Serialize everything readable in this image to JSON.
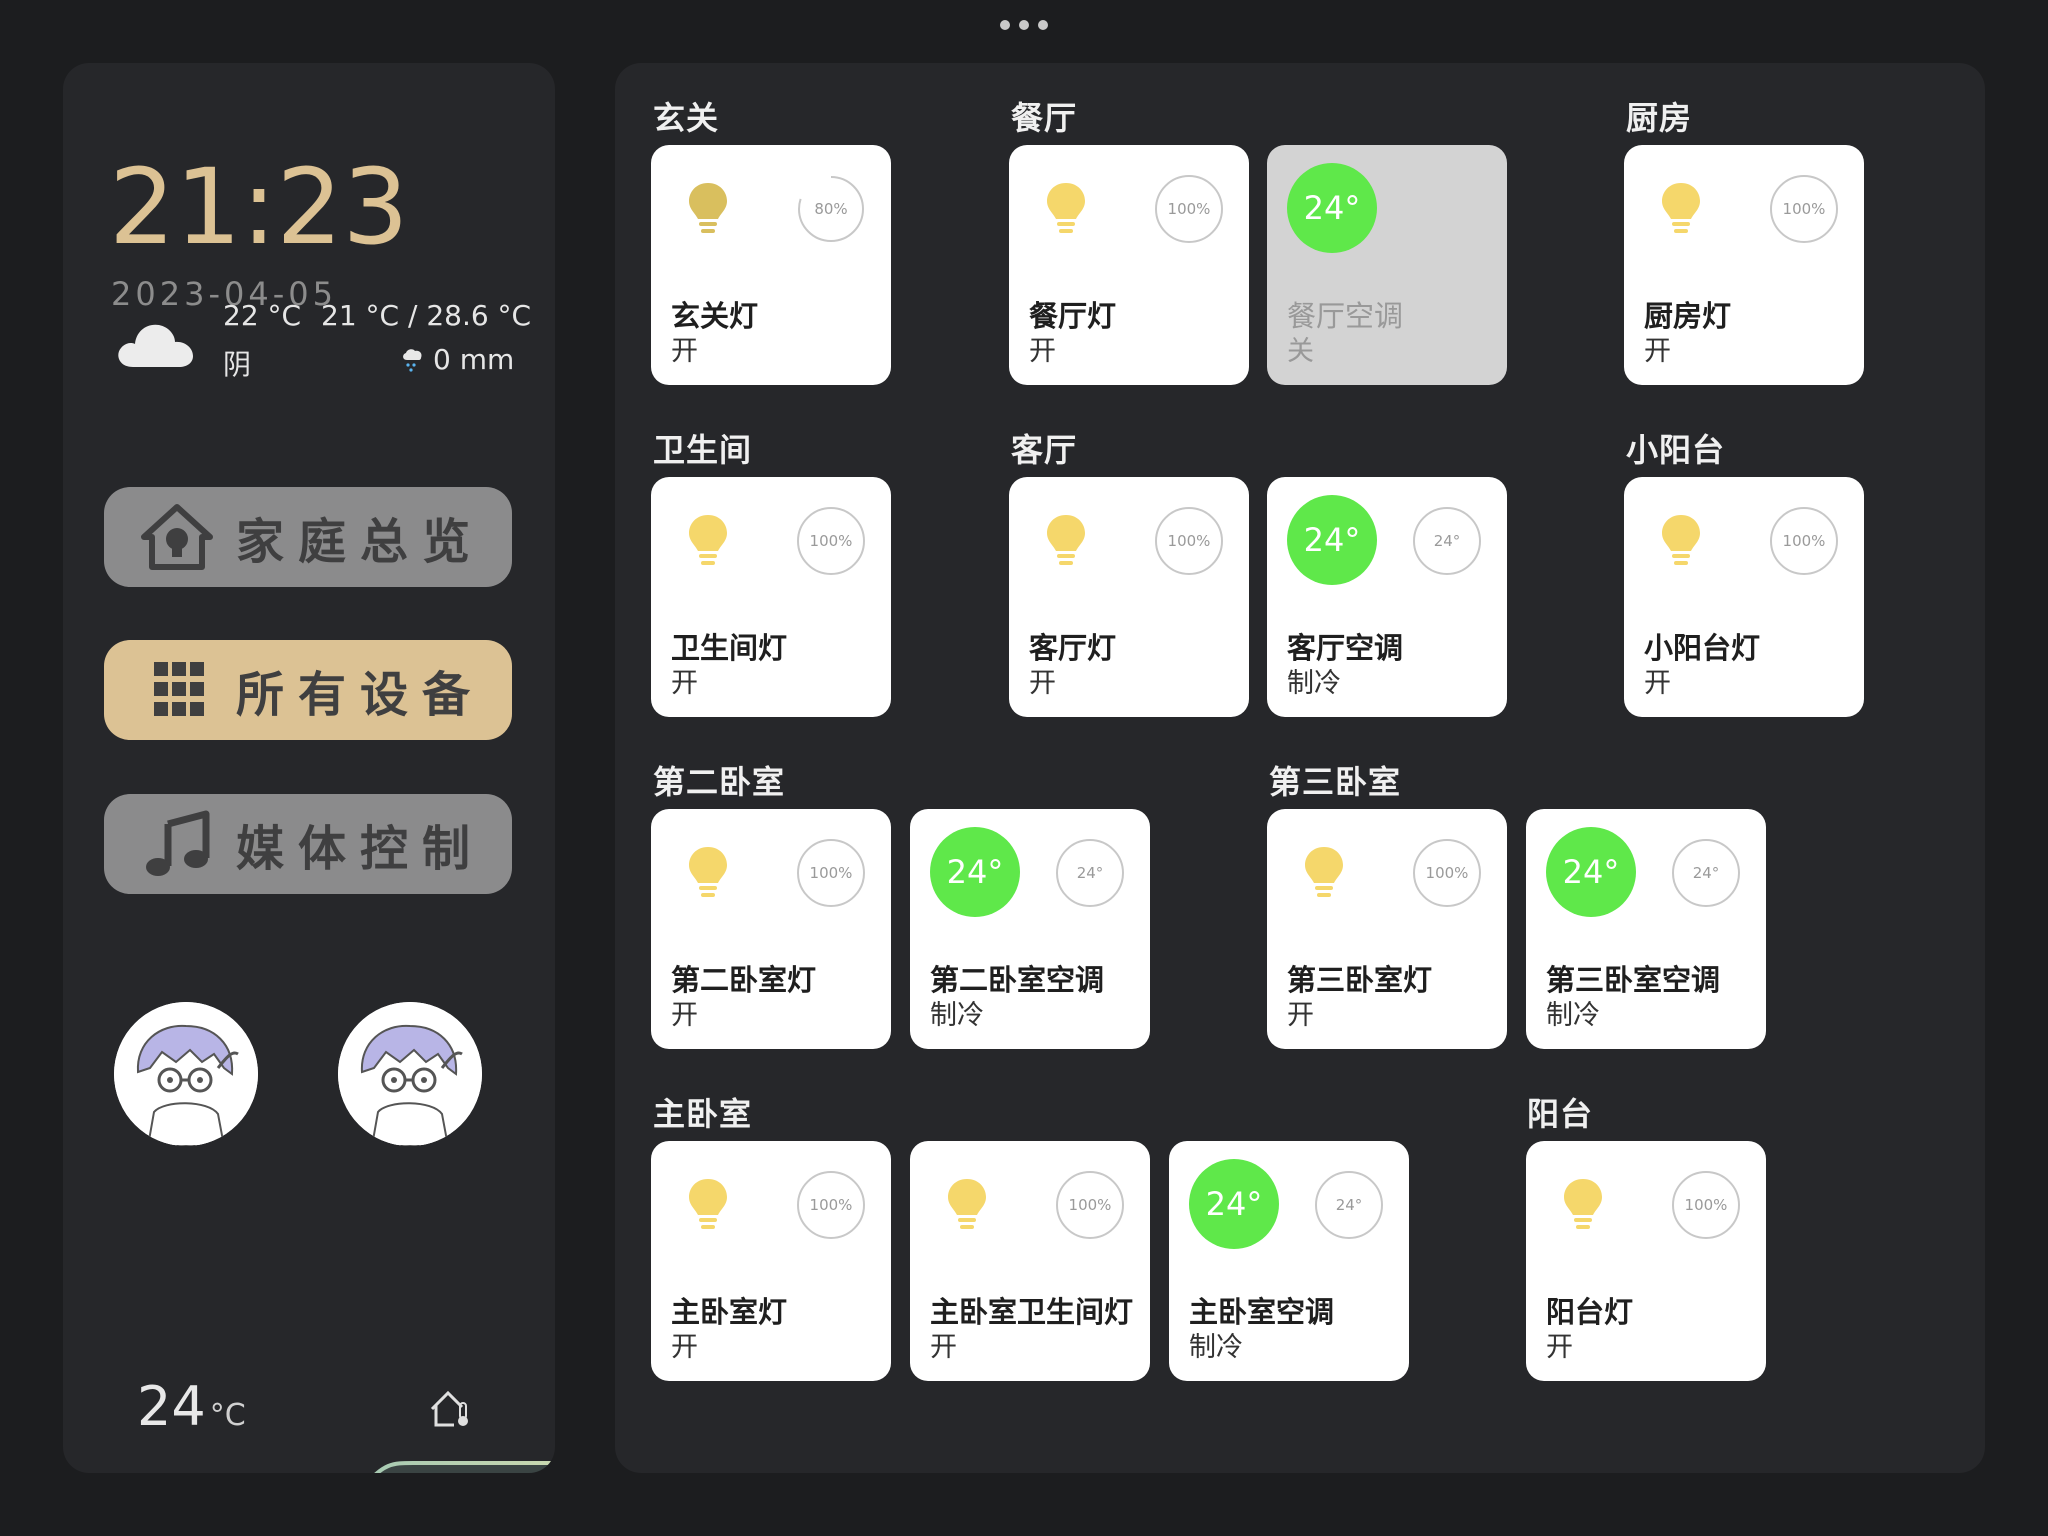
{
  "clock": {
    "time": "21:23",
    "date": "2023-04-05"
  },
  "weather": {
    "temp": "22 °C",
    "range": "21 °C / 28.6 °C",
    "condition": "阴",
    "precip": "0 mm",
    "icon": "cloud-icon"
  },
  "nav": {
    "home": "家庭总览",
    "all_devices": "所有设备",
    "media": "媒体控制",
    "active": "all_devices"
  },
  "indoor": {
    "temp": "24",
    "unit": "°C"
  },
  "colors": {
    "accent_gold": "#dcc294",
    "ac_on": "#5fe84a",
    "bulb_on": "#f5d76b",
    "bulb_dim": "#d9bf5e"
  },
  "rooms": {
    "r0": {
      "title": "玄关"
    },
    "r1": {
      "title": "餐厅"
    },
    "r2": {
      "title": "厨房"
    },
    "r3": {
      "title": "卫生间"
    },
    "r4": {
      "title": "客厅"
    },
    "r5": {
      "title": "小阳台"
    },
    "r6": {
      "title": "第二卧室"
    },
    "r7": {
      "title": "第三卧室"
    },
    "r8": {
      "title": "主卧室"
    },
    "r9": {
      "title": "阳台"
    }
  },
  "devices": {
    "d0": {
      "name": "玄关灯",
      "state": "开",
      "brightness": "80%"
    },
    "d1": {
      "name": "餐厅灯",
      "state": "开",
      "brightness": "100%"
    },
    "d2": {
      "name": "餐厅空调",
      "state": "关",
      "temp": "24°"
    },
    "d3": {
      "name": "厨房灯",
      "state": "开",
      "brightness": "100%"
    },
    "d4": {
      "name": "卫生间灯",
      "state": "开",
      "brightness": "100%"
    },
    "d5": {
      "name": "客厅灯",
      "state": "开",
      "brightness": "100%"
    },
    "d6": {
      "name": "客厅空调",
      "state": "制冷",
      "temp": "24°",
      "target": "24°"
    },
    "d7": {
      "name": "小阳台灯",
      "state": "开",
      "brightness": "100%"
    },
    "d8": {
      "name": "第二卧室灯",
      "state": "开",
      "brightness": "100%"
    },
    "d9": {
      "name": "第二卧室空调",
      "state": "制冷",
      "temp": "24°",
      "target": "24°"
    },
    "d10": {
      "name": "第三卧室灯",
      "state": "开",
      "brightness": "100%"
    },
    "d11": {
      "name": "第三卧室空调",
      "state": "制冷",
      "temp": "24°",
      "target": "24°"
    },
    "d12": {
      "name": "主卧室灯",
      "state": "开",
      "brightness": "100%"
    },
    "d13": {
      "name": "主卧室卫生间灯",
      "state": "开",
      "brightness": "100%"
    },
    "d14": {
      "name": "主卧室空调",
      "state": "制冷",
      "temp": "24°",
      "target": "24°"
    },
    "d15": {
      "name": "阳台灯",
      "state": "开",
      "brightness": "100%"
    }
  }
}
